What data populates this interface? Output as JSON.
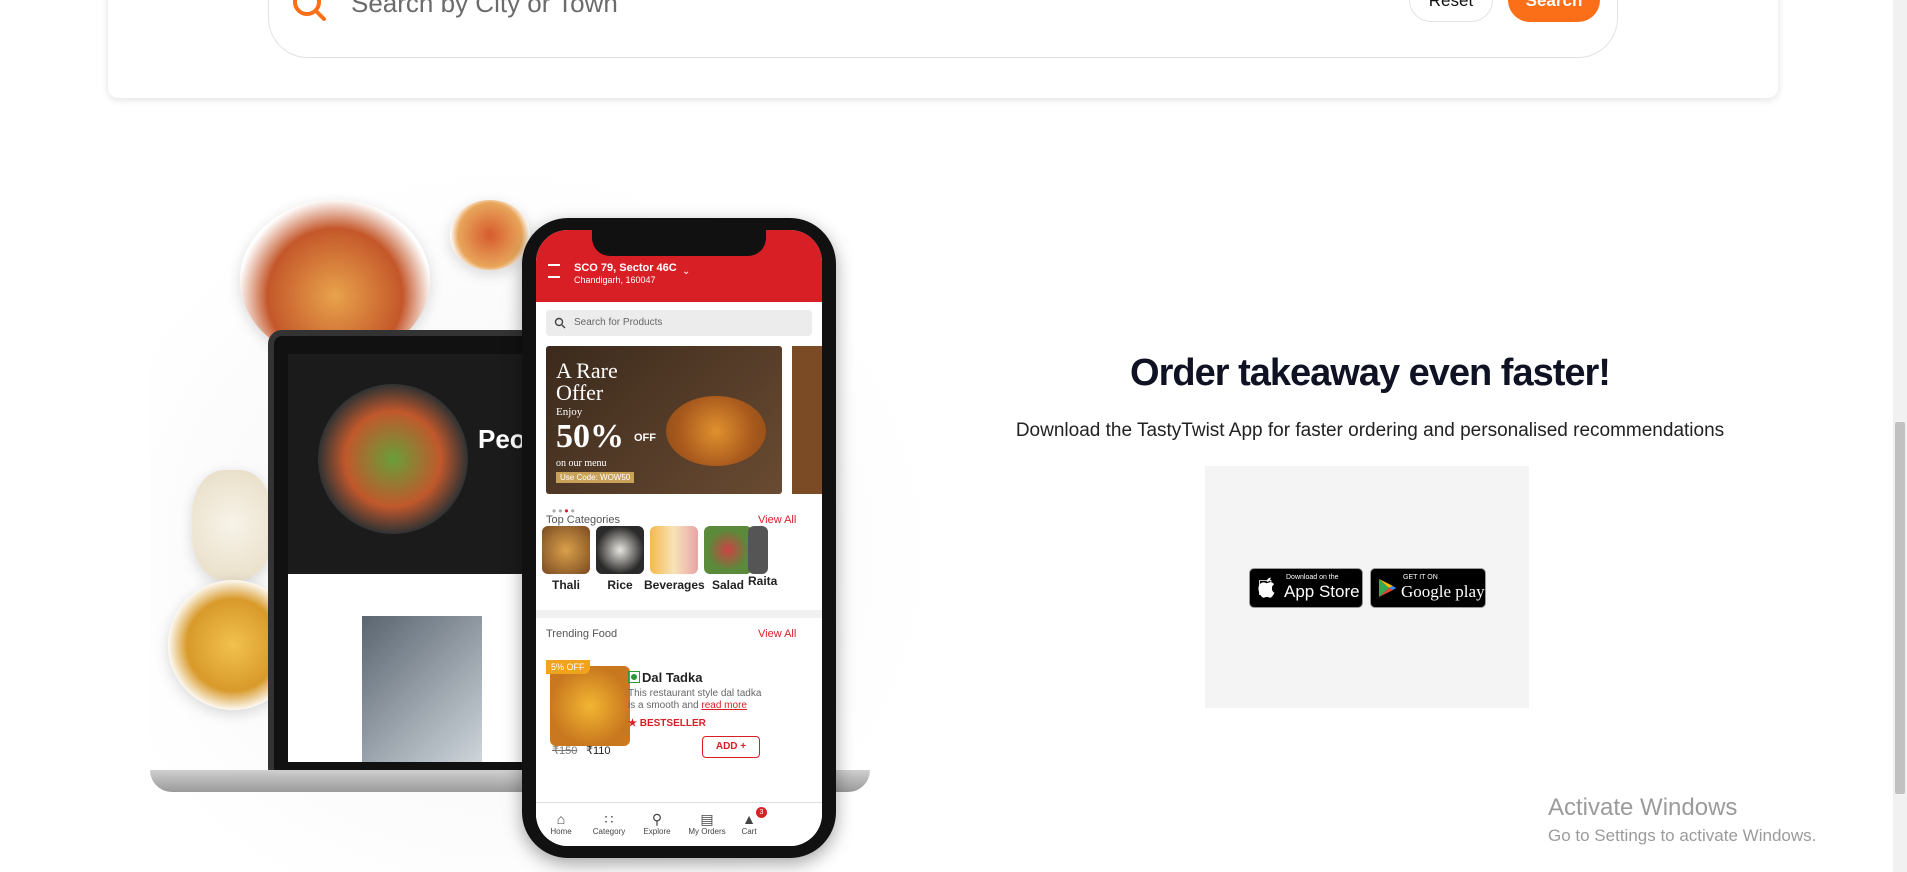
{
  "search": {
    "placeholder": "Search by City or Town",
    "reset_label": "Reset",
    "search_label": "Search"
  },
  "phone": {
    "address_line1": "SCO 79, Sector 46C",
    "address_line2": "Chandigarh, 160047",
    "search_placeholder": "Search for Products",
    "banner": {
      "title1": "A Rare",
      "title2": "Offer",
      "enjoy": "Enjoy",
      "percent": "50%",
      "off": "OFF",
      "on_menu": "on our menu",
      "code": "Use Code: WOW50"
    },
    "top_categories_label": "Top Categories",
    "view_all": "View All",
    "categories": [
      "Thali",
      "Rice",
      "Beverages",
      "Salad",
      "Raita"
    ],
    "trending_label": "Trending  Food",
    "dish": {
      "offer": "5% OFF",
      "name": "Dal Tadka",
      "desc": "This restaurant style dal tadka is a smooth and",
      "read_more": "read more",
      "badge": "BESTSELLER",
      "old_price": "₹150",
      "new_price": "₹110",
      "add_label": "ADD +"
    },
    "tabs": [
      "Home",
      "Category",
      "Explore",
      "My Orders",
      "Cart"
    ],
    "cart_count": "3",
    "laptop_text": "Peo"
  },
  "promo": {
    "title": "Order takeaway even faster!",
    "subtitle": "Download the TastyTwist App for faster ordering and personalised recommendations",
    "appstore_small": "Download on the",
    "appstore_big": "App Store",
    "googleplay_small": "GET IT ON",
    "googleplay_big": "Google play"
  },
  "watermark": {
    "line1": "Activate Windows",
    "line2": "Go to Settings to activate Windows."
  },
  "colors": {
    "accent": "#fa6f17",
    "brand_red": "#d91f26"
  }
}
